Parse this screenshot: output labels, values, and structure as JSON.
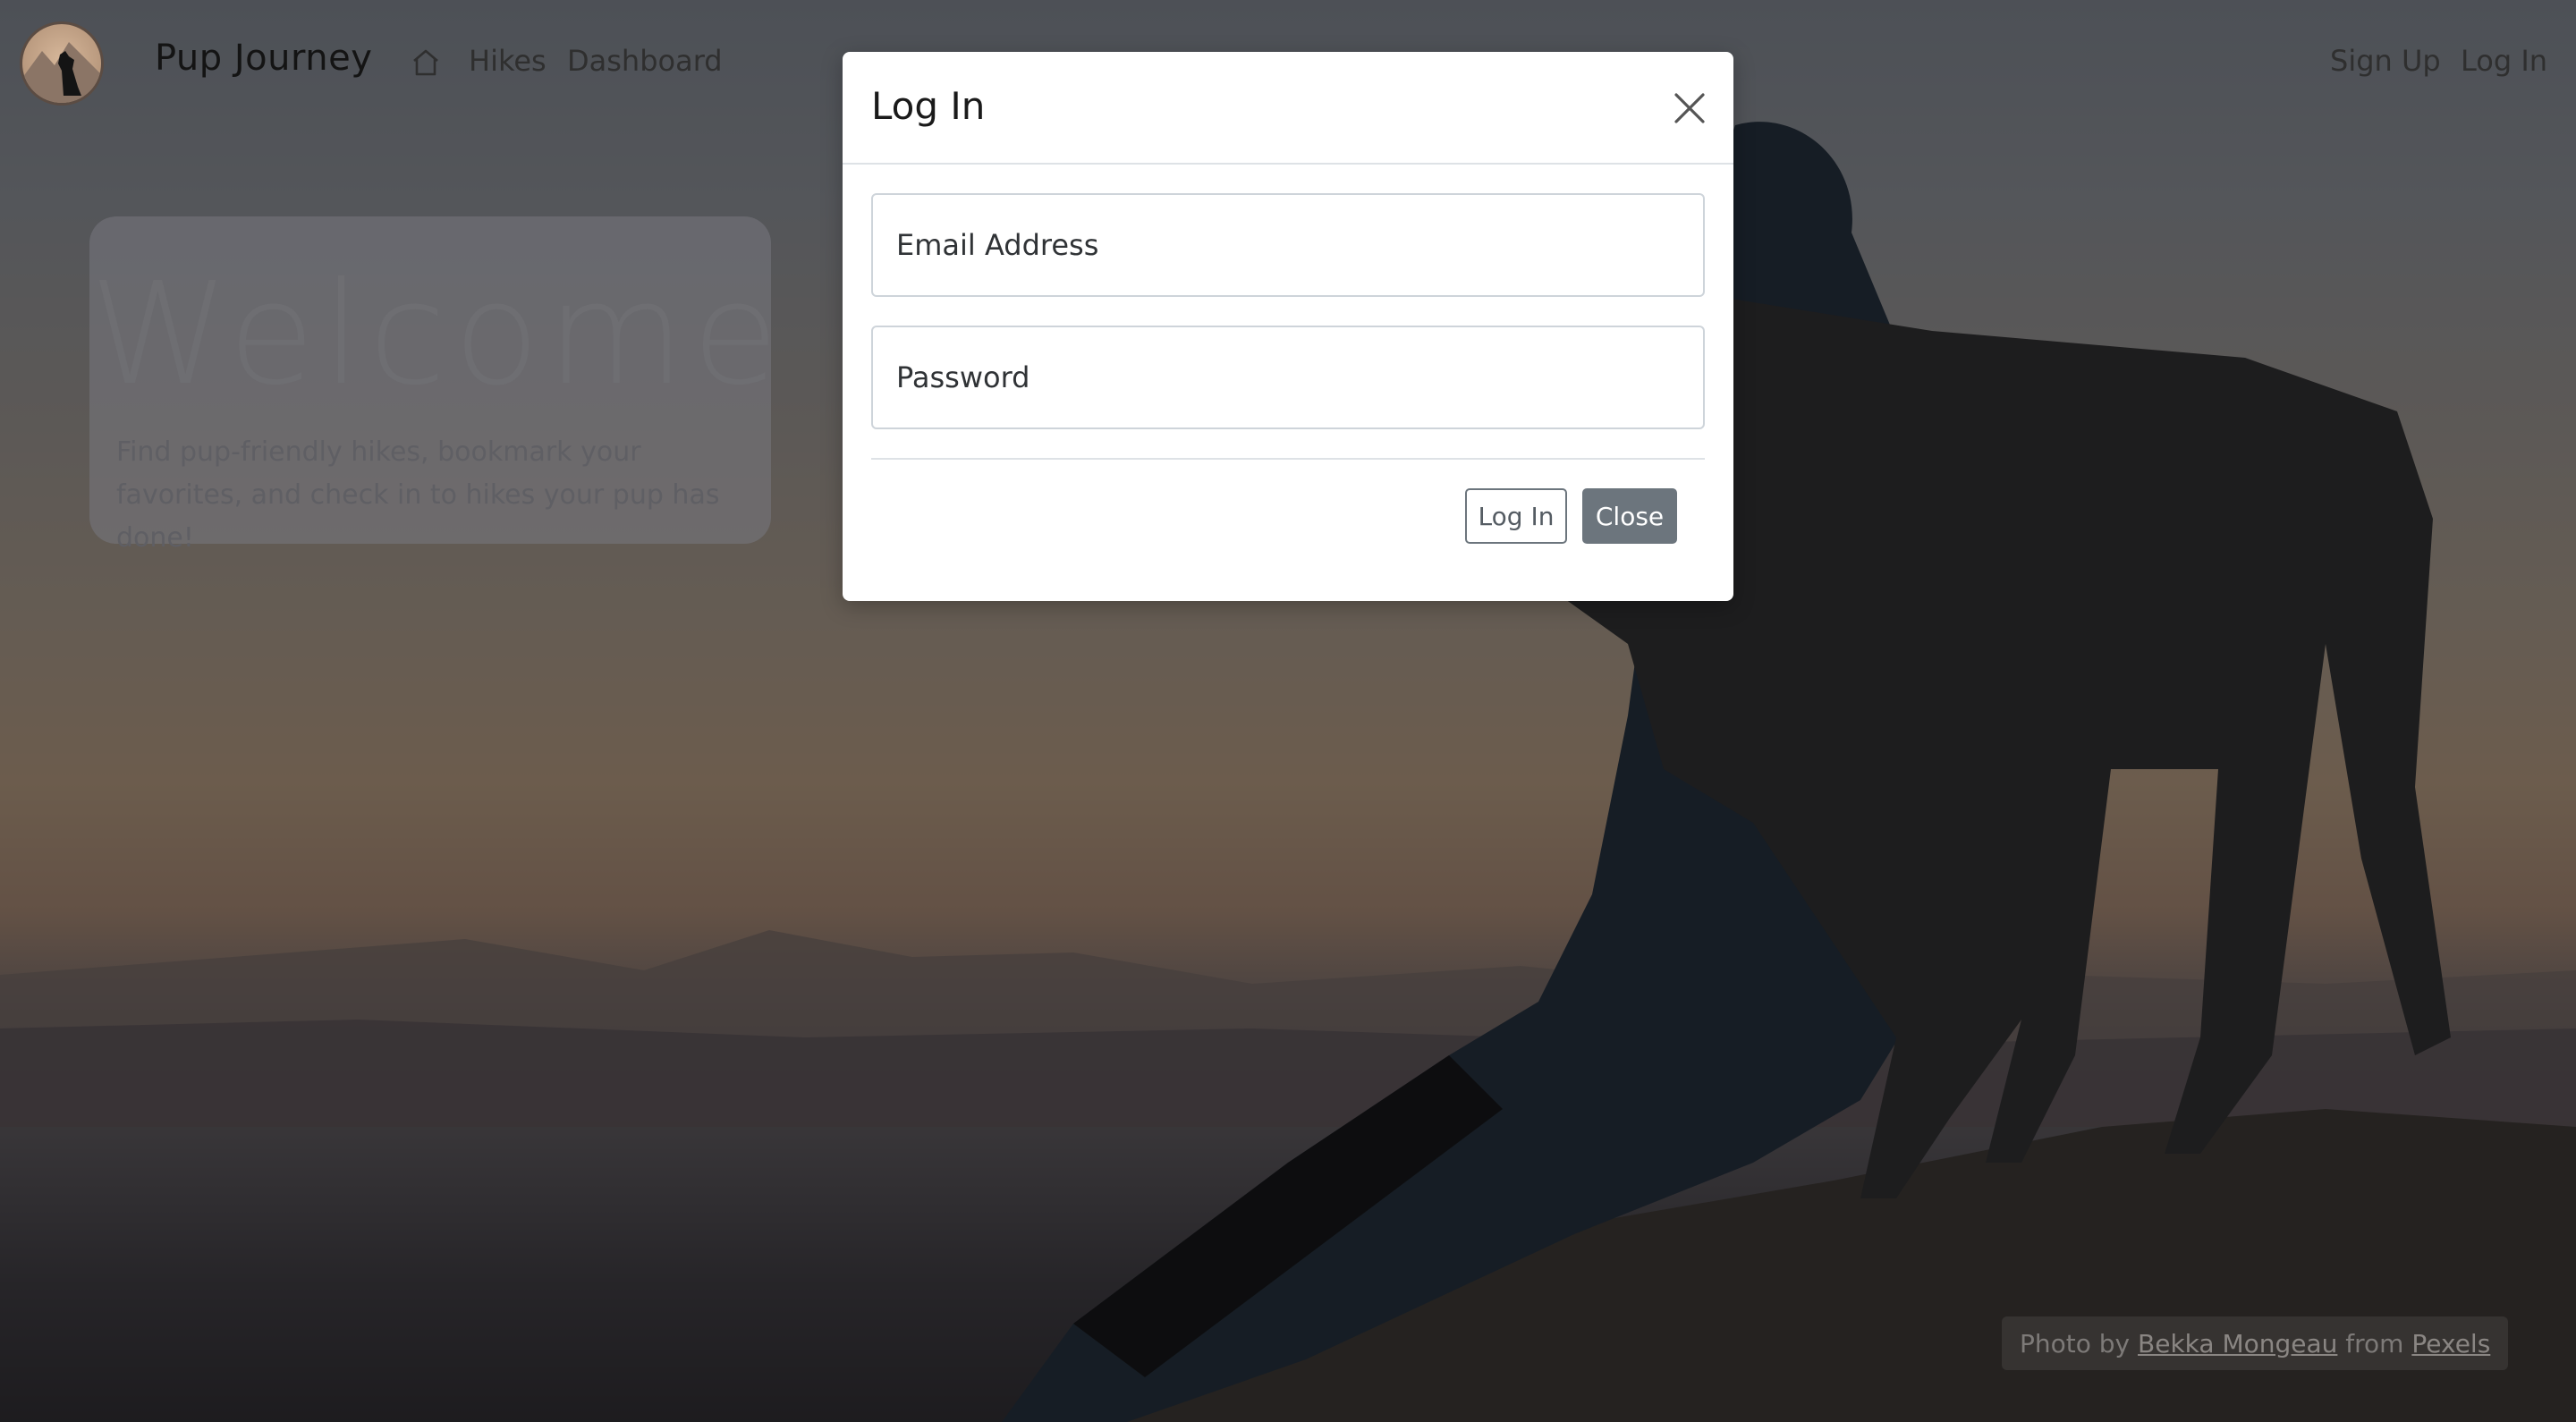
{
  "navbar": {
    "brand": "Pup Journey",
    "links": {
      "hikes": "Hikes",
      "dashboard": "Dashboard",
      "signup": "Sign Up",
      "login": "Log In"
    },
    "icons": {
      "home": "home-icon",
      "logo": "dog-mountain-logo"
    }
  },
  "hero": {
    "title": "Welcome",
    "subtitle": "Find pup-friendly hikes, bookmark your favorites, and check in to hikes your pup has done!"
  },
  "credit": {
    "prefix": "Photo by ",
    "author": "Bekka Mongeau",
    "middle": " from ",
    "source": "Pexels"
  },
  "modal": {
    "title": "Log In",
    "close_icon": "close-icon",
    "email": {
      "placeholder": "Email Address",
      "value": ""
    },
    "password": {
      "placeholder": "Password",
      "value": ""
    },
    "login_button": "Log In",
    "close_button": "Close"
  },
  "colors": {
    "overlay": "#00000080",
    "secondary": "#6c757d",
    "modal_bg": "#ffffff"
  }
}
